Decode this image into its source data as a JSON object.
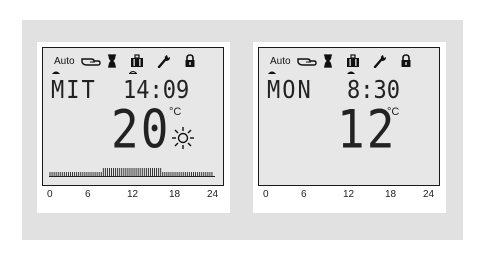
{
  "panels": [
    {
      "mode": "Auto",
      "day": "MIT",
      "time": "14:09",
      "temperature": "20",
      "unit": "°C",
      "weather": "sun-icon",
      "program_profile": "heating schedule bar 0-24h",
      "axis_labels": [
        "0",
        "6",
        "12",
        "18",
        "24"
      ]
    },
    {
      "mode": "Auto",
      "day": "MON",
      "time": "8:30",
      "temperature": "12",
      "unit": "°C",
      "axis_labels": [
        "0",
        "6",
        "12",
        "18",
        "24"
      ]
    }
  ],
  "icons": [
    "hand-icon",
    "hourglass-icon",
    "suitcase-icon",
    "wrench-icon",
    "lock-icon"
  ],
  "colors": {
    "lcd_background": "#e7e7e7",
    "outer_frame": "#e1e1e1",
    "segment": "#222222"
  }
}
